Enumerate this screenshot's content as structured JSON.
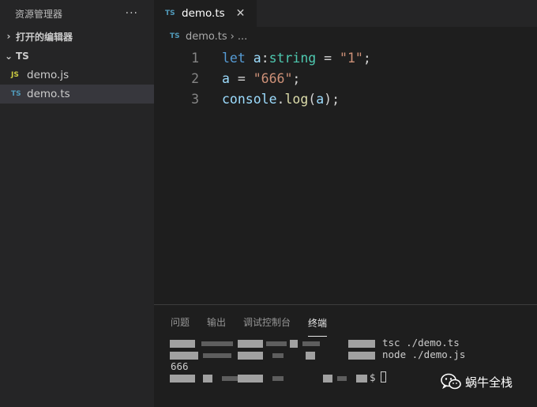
{
  "sidebar": {
    "title": "资源管理器",
    "more_glyph": "···",
    "open_editors_label": "打开的编辑器",
    "folder_label": "TS",
    "files": [
      {
        "badge": "JS",
        "name": "demo.js"
      },
      {
        "badge": "TS",
        "name": "demo.ts"
      }
    ],
    "chev_right": "›",
    "chev_down": "⌄"
  },
  "editor": {
    "tab": {
      "badge": "TS",
      "name": "demo.ts",
      "close_glyph": "✕"
    },
    "breadcrumb": {
      "badge": "TS",
      "file": "demo.ts",
      "sep": "›",
      "more": "..."
    },
    "lines": [
      {
        "n": "1"
      },
      {
        "n": "2"
      },
      {
        "n": "3"
      }
    ],
    "code": {
      "l1": {
        "kw": "let",
        "var": "a",
        "colon": ":",
        "type": "string",
        "rest": " = ",
        "str": "\"1\"",
        "end": ";"
      },
      "l2": {
        "var": "a",
        "rest": " = ",
        "str": "\"666\"",
        "end": ";"
      },
      "l3": {
        "obj": "console",
        "dot": ".",
        "fn": "log",
        "open": "(",
        "arg": "a",
        "close": ");"
      }
    }
  },
  "panel": {
    "tabs": [
      "问题",
      "输出",
      "调试控制台",
      "终端"
    ],
    "active_tab": "终端",
    "terminal": {
      "cmd1": "tsc ./demo.ts",
      "cmd2": "node ./demo.js",
      "output": "666",
      "prompt": "$"
    }
  },
  "watermark": {
    "text": "蜗牛全栈"
  },
  "colors": {
    "sidebar_bg": "#252526",
    "editor_bg": "#1e1e1e",
    "keyword": "#569cd6",
    "variable": "#9cdcfe",
    "type": "#4ec9b0",
    "string": "#ce9178",
    "function": "#dcdcaa",
    "js_badge": "#cbcb41",
    "ts_badge": "#519aba"
  }
}
